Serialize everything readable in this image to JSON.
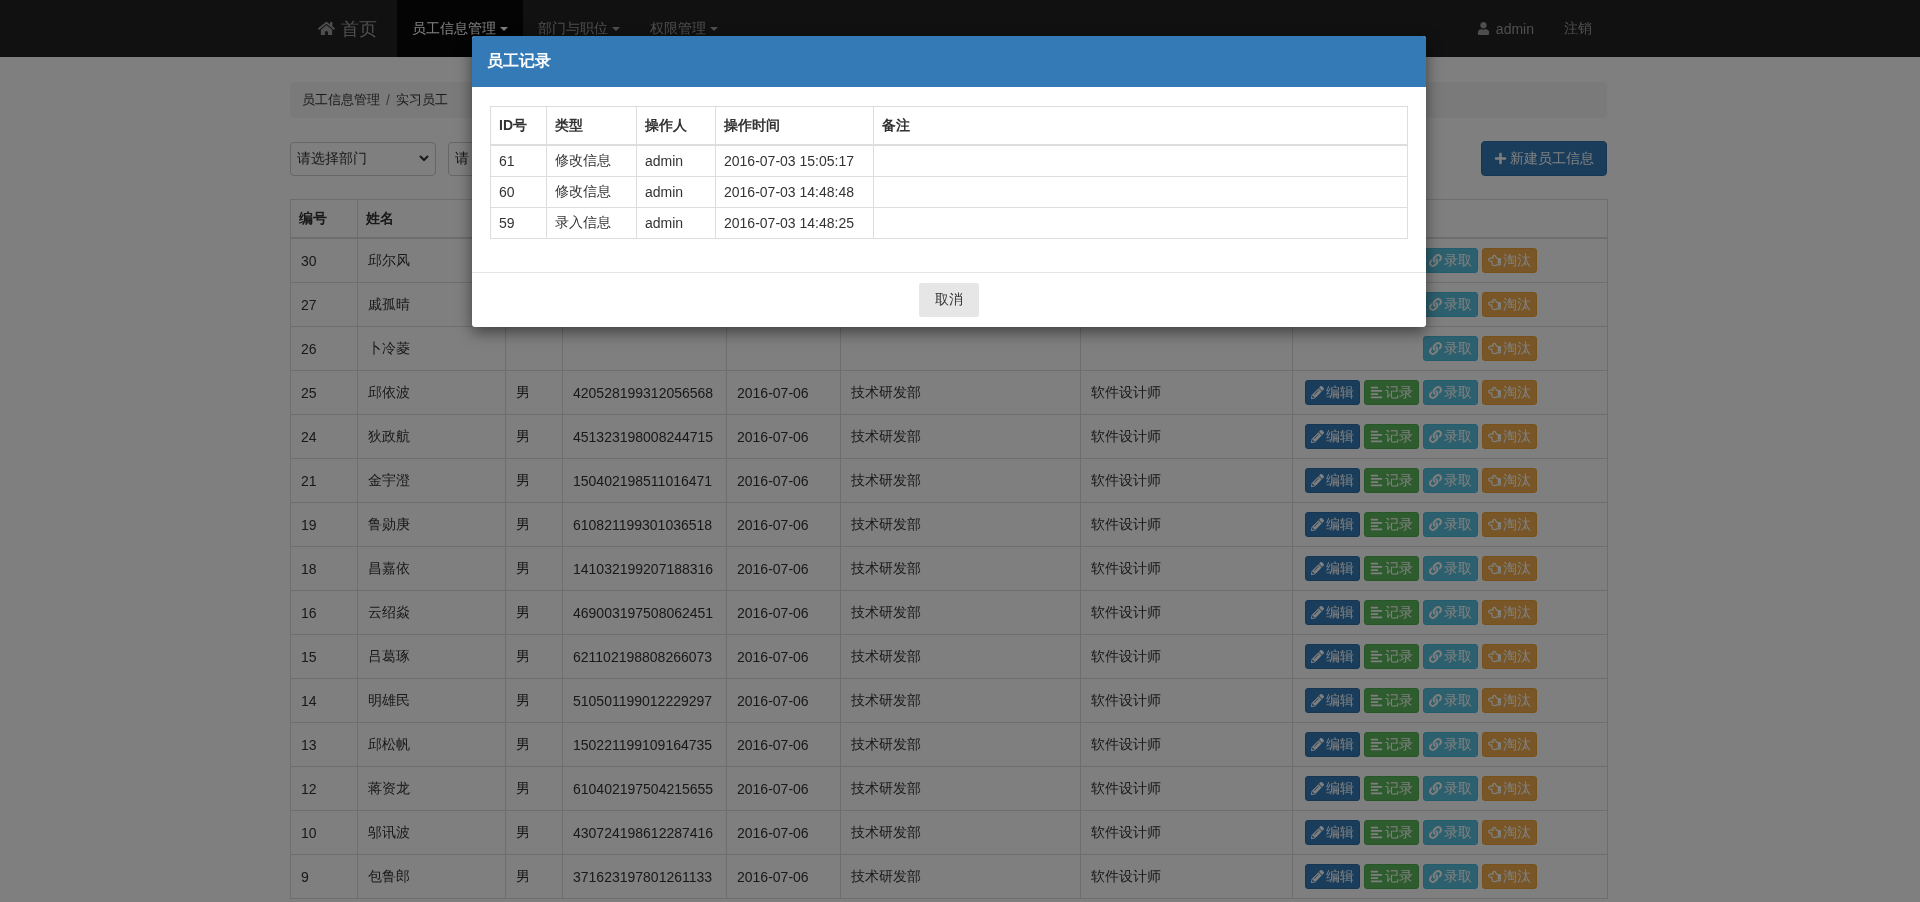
{
  "navbar": {
    "home": "首页",
    "menus": [
      {
        "label": "员工信息管理",
        "selected": true
      },
      {
        "label": "部门与职位",
        "selected": false
      },
      {
        "label": "权限管理",
        "selected": false
      }
    ],
    "user": "admin",
    "logout": "注销"
  },
  "breadcrumb": {
    "items": [
      "员工信息管理",
      "实习员工"
    ],
    "separator": "/"
  },
  "toolbar": {
    "department_select": "请选择部门",
    "second_select": "请",
    "new_button": "新建员工信息"
  },
  "table": {
    "columns": [
      "编号",
      "姓名"
    ],
    "rows": [
      {
        "id": "30",
        "name": "邱尔风",
        "actions": [
          {
            "kind": "hire",
            "label": "录取"
          },
          {
            "kind": "fire",
            "label": "淘汰"
          }
        ]
      },
      {
        "id": "27",
        "name": "戚孤晴",
        "actions": [
          {
            "kind": "hire",
            "label": "录取"
          },
          {
            "kind": "fire",
            "label": "淘汰"
          }
        ]
      },
      {
        "id": "26",
        "name": "卜冷菱",
        "actions": [
          {
            "kind": "hire",
            "label": "录取"
          },
          {
            "kind": "fire",
            "label": "淘汰"
          }
        ]
      },
      {
        "id": "25",
        "name": "邱依波",
        "gender": "男",
        "id_number": "420528199312056568",
        "date": "2016-07-06",
        "department": "技术研发部",
        "position": "软件设计师",
        "actions": [
          {
            "kind": "edit",
            "label": "编辑"
          },
          {
            "kind": "log",
            "label": "记录"
          },
          {
            "kind": "hire",
            "label": "录取"
          },
          {
            "kind": "fire",
            "label": "淘汰"
          }
        ]
      },
      {
        "id": "24",
        "name": "狄政航",
        "gender": "男",
        "id_number": "451323198008244715",
        "date": "2016-07-06",
        "department": "技术研发部",
        "position": "软件设计师",
        "actions": [
          {
            "kind": "edit",
            "label": "编辑"
          },
          {
            "kind": "log",
            "label": "记录"
          },
          {
            "kind": "hire",
            "label": "录取"
          },
          {
            "kind": "fire",
            "label": "淘汰"
          }
        ]
      },
      {
        "id": "21",
        "name": "金宇澄",
        "gender": "男",
        "id_number": "150402198511016471",
        "date": "2016-07-06",
        "department": "技术研发部",
        "position": "软件设计师",
        "actions": [
          {
            "kind": "edit",
            "label": "编辑"
          },
          {
            "kind": "log",
            "label": "记录"
          },
          {
            "kind": "hire",
            "label": "录取"
          },
          {
            "kind": "fire",
            "label": "淘汰"
          }
        ]
      },
      {
        "id": "19",
        "name": "鲁勋庚",
        "gender": "男",
        "id_number": "610821199301036518",
        "date": "2016-07-06",
        "department": "技术研发部",
        "position": "软件设计师",
        "actions": [
          {
            "kind": "edit",
            "label": "编辑"
          },
          {
            "kind": "log",
            "label": "记录"
          },
          {
            "kind": "hire",
            "label": "录取"
          },
          {
            "kind": "fire",
            "label": "淘汰"
          }
        ]
      },
      {
        "id": "18",
        "name": "昌嘉依",
        "gender": "男",
        "id_number": "141032199207188316",
        "date": "2016-07-06",
        "department": "技术研发部",
        "position": "软件设计师",
        "actions": [
          {
            "kind": "edit",
            "label": "编辑"
          },
          {
            "kind": "log",
            "label": "记录"
          },
          {
            "kind": "hire",
            "label": "录取"
          },
          {
            "kind": "fire",
            "label": "淘汰"
          }
        ]
      },
      {
        "id": "16",
        "name": "云绍焱",
        "gender": "男",
        "id_number": "469003197508062451",
        "date": "2016-07-06",
        "department": "技术研发部",
        "position": "软件设计师",
        "actions": [
          {
            "kind": "edit",
            "label": "编辑"
          },
          {
            "kind": "log",
            "label": "记录"
          },
          {
            "kind": "hire",
            "label": "录取"
          },
          {
            "kind": "fire",
            "label": "淘汰"
          }
        ]
      },
      {
        "id": "15",
        "name": "吕葛琢",
        "gender": "男",
        "id_number": "621102198808266073",
        "date": "2016-07-06",
        "department": "技术研发部",
        "position": "软件设计师",
        "actions": [
          {
            "kind": "edit",
            "label": "编辑"
          },
          {
            "kind": "log",
            "label": "记录"
          },
          {
            "kind": "hire",
            "label": "录取"
          },
          {
            "kind": "fire",
            "label": "淘汰"
          }
        ]
      },
      {
        "id": "14",
        "name": "明雄民",
        "gender": "男",
        "id_number": "510501199012229297",
        "date": "2016-07-06",
        "department": "技术研发部",
        "position": "软件设计师",
        "actions": [
          {
            "kind": "edit",
            "label": "编辑"
          },
          {
            "kind": "log",
            "label": "记录"
          },
          {
            "kind": "hire",
            "label": "录取"
          },
          {
            "kind": "fire",
            "label": "淘汰"
          }
        ]
      },
      {
        "id": "13",
        "name": "邱松帆",
        "gender": "男",
        "id_number": "150221199109164735",
        "date": "2016-07-06",
        "department": "技术研发部",
        "position": "软件设计师",
        "actions": [
          {
            "kind": "edit",
            "label": "编辑"
          },
          {
            "kind": "log",
            "label": "记录"
          },
          {
            "kind": "hire",
            "label": "录取"
          },
          {
            "kind": "fire",
            "label": "淘汰"
          }
        ]
      },
      {
        "id": "12",
        "name": "蒋资龙",
        "gender": "男",
        "id_number": "610402197504215655",
        "date": "2016-07-06",
        "department": "技术研发部",
        "position": "软件设计师",
        "actions": [
          {
            "kind": "edit",
            "label": "编辑"
          },
          {
            "kind": "log",
            "label": "记录"
          },
          {
            "kind": "hire",
            "label": "录取"
          },
          {
            "kind": "fire",
            "label": "淘汰"
          }
        ]
      },
      {
        "id": "10",
        "name": "邬讯波",
        "gender": "男",
        "id_number": "430724198612287416",
        "date": "2016-07-06",
        "department": "技术研发部",
        "position": "软件设计师",
        "actions": [
          {
            "kind": "edit",
            "label": "编辑"
          },
          {
            "kind": "log",
            "label": "记录"
          },
          {
            "kind": "hire",
            "label": "录取"
          },
          {
            "kind": "fire",
            "label": "淘汰"
          }
        ]
      },
      {
        "id": "9",
        "name": "包鲁郎",
        "gender": "男",
        "id_number": "371623197801261133",
        "date": "2016-07-06",
        "department": "技术研发部",
        "position": "软件设计师",
        "actions": [
          {
            "kind": "edit",
            "label": "编辑"
          },
          {
            "kind": "log",
            "label": "记录"
          },
          {
            "kind": "hire",
            "label": "录取"
          },
          {
            "kind": "fire",
            "label": "淘汰"
          }
        ]
      }
    ]
  },
  "modal": {
    "title": "员工记录",
    "columns": [
      "ID号",
      "类型",
      "操作人",
      "操作时间",
      "备注"
    ],
    "rows": [
      [
        "61",
        "修改信息",
        "admin",
        "2016-07-03 15:05:17"
      ],
      [
        "60",
        "修改信息",
        "admin",
        "2016-07-03 14:48:48"
      ],
      [
        "59",
        "录入信息",
        "admin",
        "2016-07-03 14:48:25"
      ]
    ],
    "cancel": "取消"
  }
}
